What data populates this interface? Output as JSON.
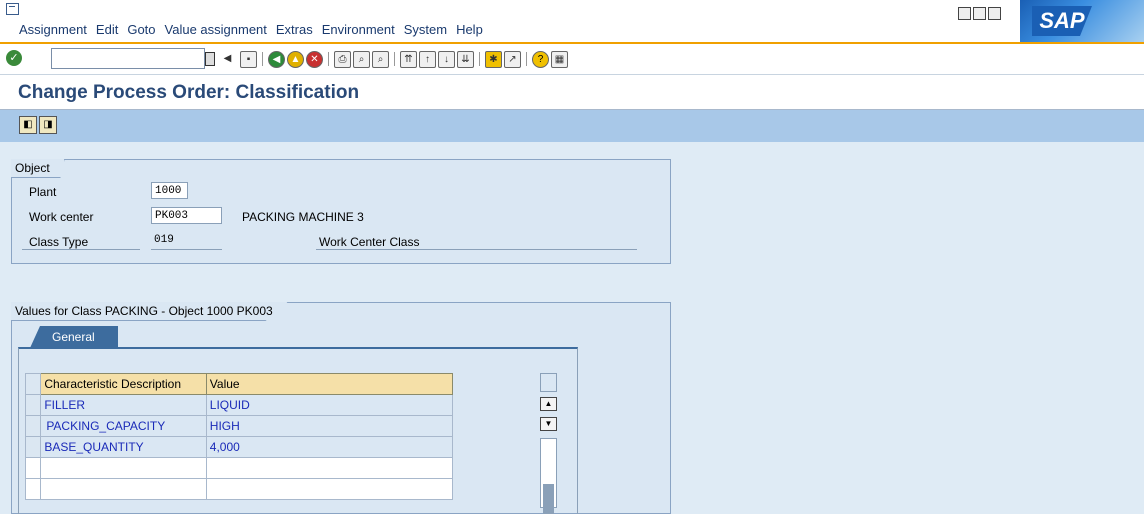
{
  "menu": [
    "Assignment",
    "Edit",
    "Goto",
    "Value assignment",
    "Extras",
    "Environment",
    "System",
    "Help"
  ],
  "brand": "SAP",
  "page_title": "Change Process Order: Classification",
  "object_group": {
    "title": "Object",
    "plant_label": "Plant",
    "plant_value": "1000",
    "work_center_label": "Work center",
    "work_center_value": "PK003",
    "work_center_desc": "PACKING MACHINE 3",
    "class_type_label": "Class Type",
    "class_type_value": "019",
    "class_type_desc": "Work Center Class"
  },
  "values_group": {
    "title": "Values for Class PACKING - Object 1000 PK003",
    "tab_label": "General",
    "columns": [
      "Characteristic Description",
      "Value"
    ],
    "rows": [
      {
        "desc": "FILLER",
        "value": "LIQUID"
      },
      {
        "desc": "PACKING_CAPACITY",
        "value": "HIGH"
      },
      {
        "desc": "BASE_QUANTITY",
        "value": "4,000"
      }
    ]
  },
  "colors": {
    "accent": "#f0a000",
    "title": "#2a4a78",
    "link": "#1a2ab8"
  }
}
